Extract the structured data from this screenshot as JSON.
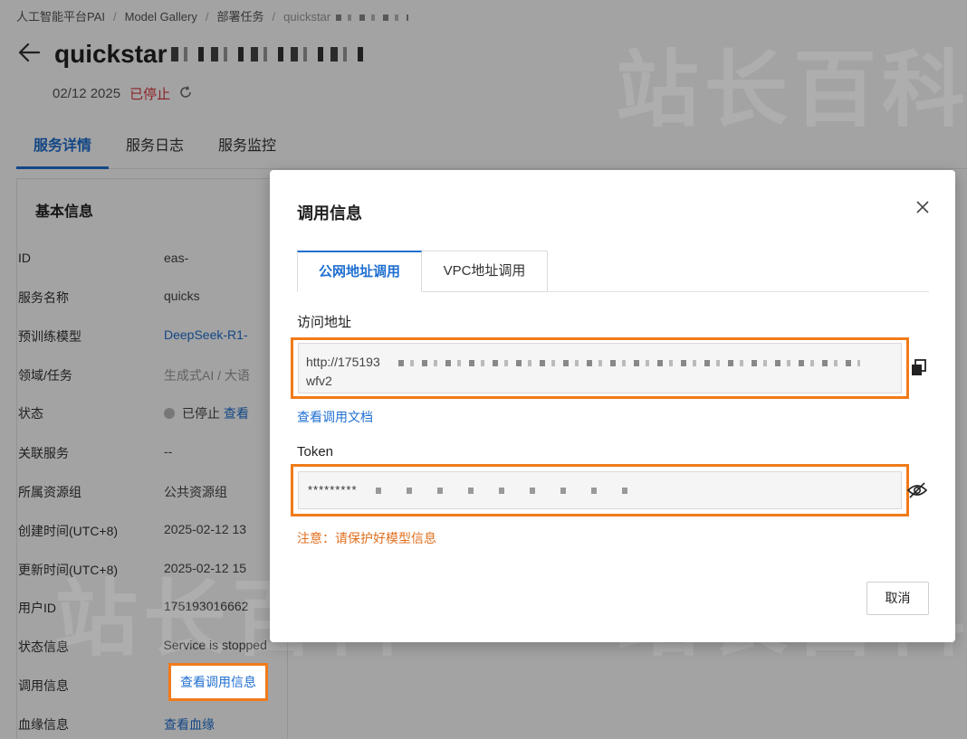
{
  "breadcrumb": {
    "items": [
      "人工智能平台PAI",
      "Model Gallery",
      "部署任务",
      "quickstar"
    ]
  },
  "header": {
    "title": "quickstar",
    "date": "02/12 2025",
    "status": "已停止",
    "refresh_icon": "refresh-icon",
    "back_icon": "arrow-left-icon"
  },
  "tabs": [
    "服务详情",
    "服务日志",
    "服务监控"
  ],
  "basic_info": {
    "title": "基本信息",
    "rows": [
      {
        "key": "ID",
        "value": "eas-"
      },
      {
        "key": "服务名称",
        "value": "quicks"
      },
      {
        "key": "预训练模型",
        "value": "DeepSeek-R1-"
      },
      {
        "key": "领域/任务",
        "value": "生成式AI / 大语"
      },
      {
        "key": "状态",
        "value": "已停止",
        "extra": "查看"
      },
      {
        "key": "关联服务",
        "value": "--"
      },
      {
        "key": "所属资源组",
        "value": "公共资源组"
      },
      {
        "key": "创建时间(UTC+8)",
        "value": "2025-02-12 13"
      },
      {
        "key": "更新时间(UTC+8)",
        "value": "2025-02-12 15"
      },
      {
        "key": "用户ID",
        "value": "175193016662"
      },
      {
        "key": "状态信息",
        "value": "Service is stopped"
      },
      {
        "key": "调用信息",
        "value": "查看调用信息"
      },
      {
        "key": "血缘信息",
        "value": "查看血缘"
      }
    ]
  },
  "watermark": "站长百科",
  "modal": {
    "title": "调用信息",
    "close_icon": "close-icon",
    "tabs": [
      "公网地址调用",
      "VPC地址调用"
    ],
    "address_label": "访问地址",
    "address_value_line1": "http://175193",
    "address_value_line2": "wfv2",
    "doc_link": "查看调用文档",
    "token_label": "Token",
    "token_value": "*********",
    "notice": "注意：请保护好模型信息",
    "cancel_label": "取消",
    "copy_icon": "copy-icon",
    "eye_icon": "eye-off-icon"
  },
  "colors": {
    "accent": "#1f6fd1",
    "highlight": "#f07b1a",
    "danger": "#d9363e",
    "warning_text": "#e07020"
  }
}
